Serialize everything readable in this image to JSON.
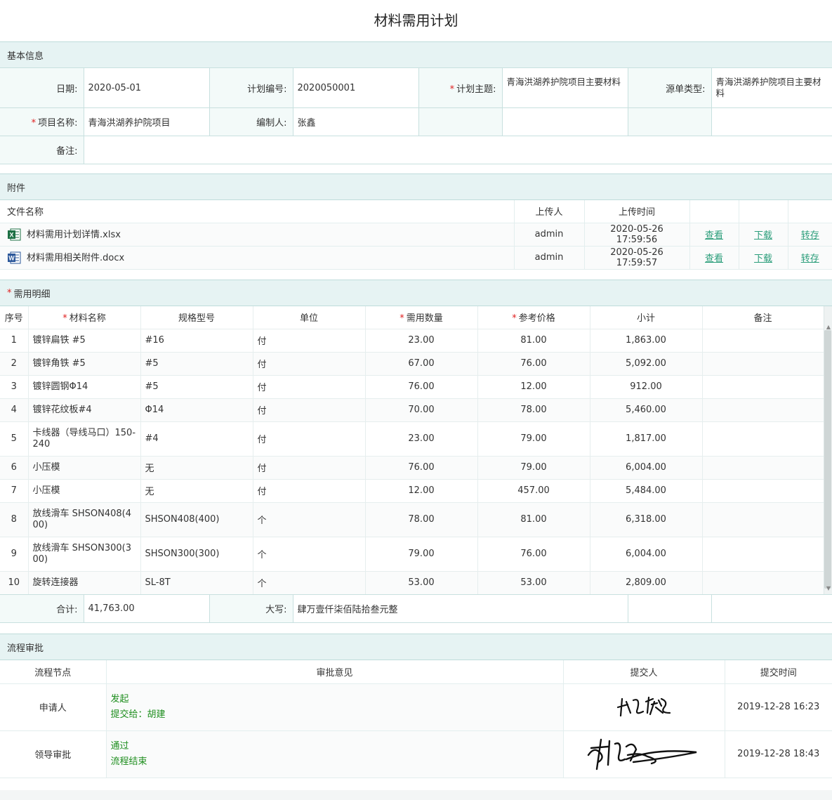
{
  "page_title": "材料需用计划",
  "sections": {
    "basic": "基本信息",
    "attachments": "附件",
    "details": "需用明细",
    "workflow": "流程审批"
  },
  "basic": {
    "date_label": "日期:",
    "date_value": "2020-05-01",
    "plan_no_label": "计划编号:",
    "plan_no_value": "2020050001",
    "subject_label": "计划主题:",
    "subject_value": "青海洪湖养护院项目主要材料",
    "source_type_label": "源单类型:",
    "source_type_value": "青海洪湖养护院项目主要材料",
    "project_label": "项目名称:",
    "project_value": "青海洪湖养护院项目",
    "author_label": "编制人:",
    "author_value": "张鑫",
    "remark_label": "备注:",
    "remark_value": ""
  },
  "attachments": {
    "headers": {
      "name": "文件名称",
      "uploader": "上传人",
      "time": "上传时间"
    },
    "files": [
      {
        "icon": "excel-file-icon",
        "name": "材料需用计划详情.xlsx",
        "uploader": "admin",
        "time": "2020-05-26 17:59:56",
        "view": "查看",
        "download": "下载",
        "save": "转存"
      },
      {
        "icon": "word-file-icon",
        "name": "材料需用相关附件.docx",
        "uploader": "admin",
        "time": "2020-05-26 17:59:57",
        "view": "查看",
        "download": "下载",
        "save": "转存"
      }
    ]
  },
  "details": {
    "headers": {
      "no": "序号",
      "name": "材料名称",
      "spec": "规格型号",
      "unit": "单位",
      "qty": "需用数量",
      "price": "参考价格",
      "subtotal": "小计",
      "remark": "备注"
    },
    "rows": [
      {
        "no": "1",
        "name": "镀锌扁铁 #5",
        "spec": "#16",
        "unit": "付",
        "qty": "23.00",
        "price": "81.00",
        "subtotal": "1,863.00",
        "remark": ""
      },
      {
        "no": "2",
        "name": "镀锌角铁 #5",
        "spec": "#5",
        "unit": "付",
        "qty": "67.00",
        "price": "76.00",
        "subtotal": "5,092.00",
        "remark": ""
      },
      {
        "no": "3",
        "name": "镀锌圆钢Φ14",
        "spec": "#5",
        "unit": "付",
        "qty": "76.00",
        "price": "12.00",
        "subtotal": "912.00",
        "remark": ""
      },
      {
        "no": "4",
        "name": "镀锌花纹板#4",
        "spec": "Φ14",
        "unit": "付",
        "qty": "70.00",
        "price": "78.00",
        "subtotal": "5,460.00",
        "remark": ""
      },
      {
        "no": "5",
        "name": "卡线器（导线马口）150-240",
        "spec": "#4",
        "unit": "付",
        "qty": "23.00",
        "price": "79.00",
        "subtotal": "1,817.00",
        "remark": ""
      },
      {
        "no": "6",
        "name": "小压模",
        "spec": "无",
        "unit": "付",
        "qty": "76.00",
        "price": "79.00",
        "subtotal": "6,004.00",
        "remark": ""
      },
      {
        "no": "7",
        "name": "小压模",
        "spec": "无",
        "unit": "付",
        "qty": "12.00",
        "price": "457.00",
        "subtotal": "5,484.00",
        "remark": ""
      },
      {
        "no": "8",
        "name": "放线滑车 SHSON408(400)",
        "spec": "SHSON408(400)",
        "unit": "个",
        "qty": "78.00",
        "price": "81.00",
        "subtotal": "6,318.00",
        "remark": ""
      },
      {
        "no": "9",
        "name": "放线滑车 SHSON300(300)",
        "spec": "SHSON300(300)",
        "unit": "个",
        "qty": "79.00",
        "price": "76.00",
        "subtotal": "6,004.00",
        "remark": ""
      },
      {
        "no": "10",
        "name": "旋转连接器",
        "spec": "SL-8T",
        "unit": "个",
        "qty": "53.00",
        "price": "53.00",
        "subtotal": "2,809.00",
        "remark": ""
      }
    ],
    "total_label": "合计:",
    "total_value": "41,763.00",
    "upper_label": "大写:",
    "upper_value": "肆万壹仟柒佰陆拾叁元整"
  },
  "workflow": {
    "headers": {
      "node": "流程节点",
      "opinion": "审批意见",
      "submitter": "提交人",
      "time": "提交时间"
    },
    "rows": [
      {
        "node": "申请人",
        "opinion1": "发起",
        "opinion2": "提交给：胡建",
        "signature": "signature-zhangxin",
        "time": "2019-12-28 16:23"
      },
      {
        "node": "领导审批",
        "opinion1": "通过",
        "opinion2": "流程结束",
        "signature": "signature-hujian",
        "time": "2019-12-28 18:43"
      }
    ]
  },
  "colors": {
    "section_bg": "#e6f3f3",
    "link": "#2a9d7a",
    "required": "#e02020",
    "approval_text": "#1e8e1e"
  }
}
